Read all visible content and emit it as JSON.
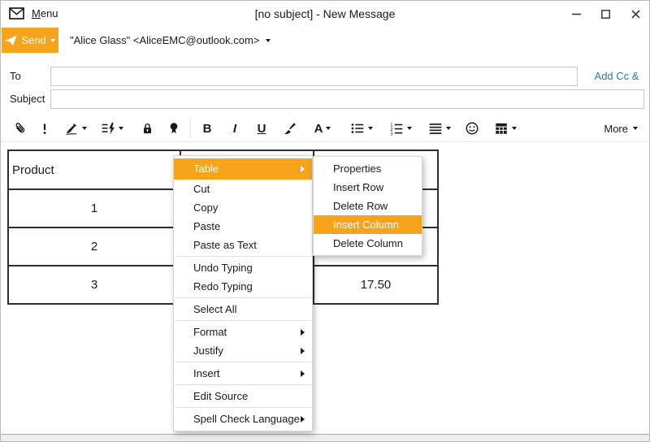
{
  "window": {
    "menu_first": "M",
    "menu_rest": "enu",
    "title": "[no subject] - New Message"
  },
  "compose": {
    "send_label": "Send",
    "from": "\"Alice Glass\" <AliceEMC@outlook.com>",
    "to_label": "To",
    "to_value": "",
    "add_cc_bcc_label": "Add Cc & Bcc",
    "subject_label": "Subject",
    "subject_value": ""
  },
  "toolbar": {
    "more_label": "More",
    "bold_label": "B",
    "italic_label": "I",
    "underline_label": "U",
    "font_label": "A",
    "icons": [
      "attach",
      "priority",
      "signature",
      "quick-text",
      "encrypt",
      "certificate",
      "bold",
      "italic",
      "underline",
      "format-painter",
      "font",
      "bulleted-list",
      "numbered-list",
      "alignment",
      "emoticon",
      "insert-table",
      "more"
    ]
  },
  "body_table": {
    "header": [
      "Product",
      "",
      ""
    ],
    "rows": [
      [
        "1",
        "",
        ""
      ],
      [
        "2",
        "",
        ""
      ],
      [
        "3",
        "",
        "17.50"
      ]
    ]
  },
  "context_menu": {
    "items": [
      {
        "label": "Table",
        "has_submenu": true,
        "highlighted": true
      },
      {
        "label": "Cut"
      },
      {
        "label": "Copy"
      },
      {
        "label": "Paste"
      },
      {
        "label": "Paste as Text"
      },
      {
        "label": "Undo Typing"
      },
      {
        "label": "Redo Typing"
      },
      {
        "label": "Select All"
      },
      {
        "label": "Format",
        "has_submenu": true
      },
      {
        "label": "Justify",
        "has_submenu": true
      },
      {
        "label": "Insert",
        "has_submenu": true
      },
      {
        "label": "Edit Source"
      },
      {
        "label": "Spell Check Language",
        "has_submenu": true
      }
    ]
  },
  "table_submenu": {
    "items": [
      {
        "label": "Properties"
      },
      {
        "label": "Insert Row"
      },
      {
        "label": "Delete Row"
      },
      {
        "label": "Insert Column",
        "highlighted": true
      },
      {
        "label": "Delete Column"
      }
    ]
  },
  "colors": {
    "accent": "#F7A41D",
    "link": "#2878C8"
  }
}
